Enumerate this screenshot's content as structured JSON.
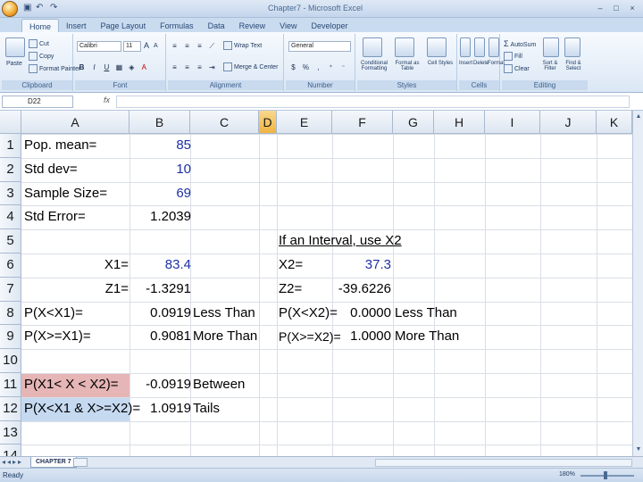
{
  "window": {
    "title": "Chapter7 - Microsoft Excel",
    "controls": [
      "–",
      "□",
      "×"
    ]
  },
  "ribbon": {
    "tabs": [
      "Home",
      "Insert",
      "Page Layout",
      "Formulas",
      "Data",
      "Review",
      "View",
      "Developer"
    ],
    "clipboard": {
      "paste": "Paste",
      "cut": "Cut",
      "copy": "Copy",
      "format_painter": "Format Painter",
      "label": "Clipboard"
    },
    "font": {
      "name": "Calibri",
      "size": "11",
      "label": "Font",
      "bold": "B",
      "italic": "I",
      "underline": "U",
      "grow": "A",
      "shrink": "A"
    },
    "alignment": {
      "wrap": "Wrap Text",
      "merge": "Merge & Center",
      "label": "Alignment"
    },
    "number": {
      "format": "General",
      "currency": "$",
      "percent": "%",
      "comma": ",",
      "label": "Number"
    },
    "styles": {
      "conditional": "Conditional Formatting",
      "format_table": "Format as Table",
      "cell_styles": "Cell Styles",
      "label": "Styles"
    },
    "cells": {
      "insert": "Insert",
      "delete": "Delete",
      "format": "Format",
      "label": "Cells"
    },
    "editing": {
      "autosum": "AutoSum",
      "fill": "Fill",
      "clear": "Clear",
      "sort": "Sort & Filter",
      "find": "Find & Select",
      "label": "Editing"
    }
  },
  "formula_bar": {
    "name_box": "D22",
    "fx": "fx",
    "content": ""
  },
  "columns": [
    "A",
    "B",
    "C",
    "D",
    "E",
    "F",
    "G",
    "H",
    "I",
    "J",
    "K"
  ],
  "selected_column": "D",
  "rows": [
    "1",
    "2",
    "3",
    "4",
    "5",
    "6",
    "7",
    "8",
    "9",
    "10",
    "11",
    "12",
    "13",
    "14"
  ],
  "cells": {
    "A1": "Pop. mean=",
    "B1": "85",
    "A2": "Std dev=",
    "B2": "10",
    "A3": "Sample Size=",
    "B3": "69",
    "A4": "Std Error=",
    "B4": "1.2039",
    "E5": "If an Interval, use X2",
    "A6": "X1=",
    "B6": "83.4",
    "E6": "X2=",
    "F6": "37.3",
    "A7": "Z1=",
    "B7": "-1.3291",
    "E7": "Z2=",
    "F7": "-39.6226",
    "A8": "P(X<X1)=",
    "B8": "0.0919",
    "C8": "Less Than",
    "E8": "P(X<X2)=",
    "F8": "0.0000",
    "G8": "Less Than",
    "A9": "P(X>=X1)=",
    "B9": "0.9081",
    "C9": "More Than",
    "E9": "P(X>=X2)=",
    "F9": "1.0000",
    "G9": "More Than",
    "A11": "P(X1< X < X2)=",
    "B11": "-0.0919",
    "C11": "Between",
    "A12": "P(X<X1 & X>=X2)=",
    "B12": "1.0919",
    "C12": "Tails"
  },
  "sheet": {
    "tab": "CHAPTER 7"
  },
  "status": {
    "ready": "Ready",
    "zoom": "180%"
  },
  "colors": {
    "highlight_pink": "#e6b5b5",
    "highlight_blue": "#c5d9f1",
    "input_blue": "#1d2fa6",
    "selected_header": "#f0b441"
  }
}
